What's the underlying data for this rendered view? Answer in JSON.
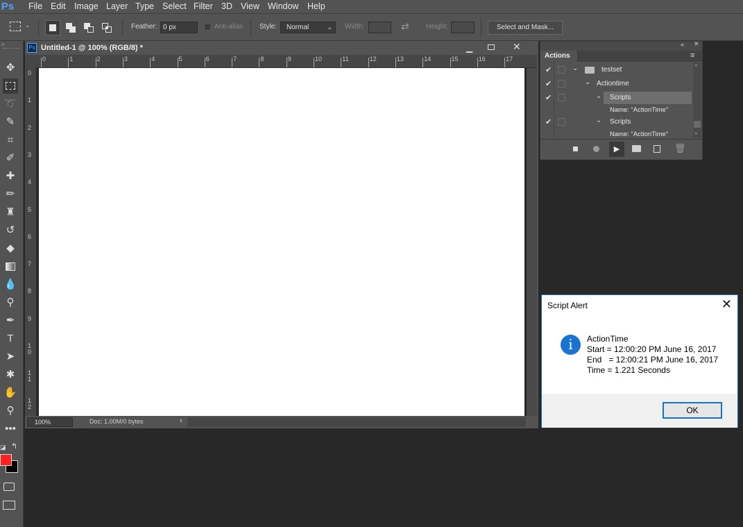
{
  "app": {
    "logo": "Ps"
  },
  "menu": [
    "File",
    "Edit",
    "Image",
    "Layer",
    "Type",
    "Select",
    "Filter",
    "3D",
    "View",
    "Window",
    "Help"
  ],
  "options": {
    "feather_label": "Feather:",
    "feather_value": "0 px",
    "antialias_label": "Anti-alias",
    "style_label": "Style:",
    "style_value": "Normal",
    "width_label": "Width:",
    "height_label": "Height:",
    "select_mask_label": "Select and Mask..."
  },
  "document": {
    "tab_title": "Untitled-1 @ 100% (RGB/8) *",
    "zoom": "100%",
    "doc_info": "Doc: 1.00M/0 bytes",
    "ruler_h": [
      "0",
      "1",
      "2",
      "3",
      "4",
      "5",
      "6",
      "7",
      "8",
      "9",
      "10",
      "11",
      "12",
      "13",
      "14",
      "15",
      "16",
      "17"
    ],
    "ruler_v": [
      "0",
      "1",
      "2",
      "3",
      "4",
      "5",
      "6",
      "7",
      "8",
      "9",
      "10",
      "11",
      "12"
    ]
  },
  "actions_panel": {
    "title": "Actions",
    "rows": [
      {
        "text": "testset",
        "checked": true
      },
      {
        "text": "Actiontime",
        "checked": true
      },
      {
        "text": "Scripts",
        "checked": true
      },
      {
        "text": "Name:  “ActionTime”",
        "checked": false
      },
      {
        "text": "Scripts",
        "checked": true
      },
      {
        "text": "Name:  “ActionTime”",
        "checked": false
      }
    ]
  },
  "alert": {
    "title": "Script Alert",
    "line1": "ActionTime",
    "line2": "Start = 12:00:20 PM June 16, 2017",
    "line3": "End   = 12:00:21 PM June 16, 2017",
    "line4": "Time = 1.221 Seconds",
    "ok_label": "OK"
  },
  "colors": {
    "foreground": "#ff2020",
    "background": "#000000",
    "accent": "#1b73d1"
  }
}
